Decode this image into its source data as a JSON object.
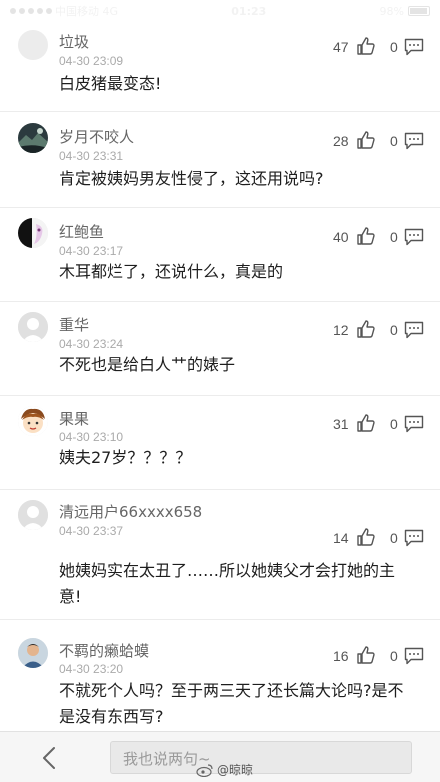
{
  "status_bar": {
    "carrier": "中国移动 4G",
    "time": "01:23",
    "battery": "98%"
  },
  "comments": [
    {
      "username": "垃圾",
      "time": "04-30 23:09",
      "text": "白皮猪最变态!",
      "likes": "47",
      "replies": "0",
      "avatar": "gray-blank-avatar"
    },
    {
      "username": "岁月不咬人",
      "time": "04-30 23:31",
      "text": "肯定被姨妈男友性侵了，这还用说吗?",
      "likes": "28",
      "replies": "0",
      "avatar": "dark-landscape-avatar"
    },
    {
      "username": "红鲍鱼",
      "time": "04-30 23:17",
      "text": "木耳都烂了，还说什么，真是的",
      "likes": "40",
      "replies": "0",
      "avatar": "black-white-cartoon-avatar"
    },
    {
      "username": "重华",
      "time": "04-30 23:24",
      "text": "不死也是给白人艹的婊子",
      "likes": "12",
      "replies": "0",
      "avatar": "default-person-avatar"
    },
    {
      "username": "果果",
      "time": "04-30 23:10",
      "text": "姨夫27岁？？？？",
      "likes": "31",
      "replies": "0",
      "avatar": "cartoon-face-avatar"
    },
    {
      "username": "清远用户66xxxx658",
      "time": "04-30 23:37",
      "text": "她姨妈实在太丑了……所以她姨父才会打她的主意!",
      "likes": "14",
      "replies": "0",
      "avatar": "default-person-avatar"
    },
    {
      "username": "不羁的癞蛤蟆",
      "time": "04-30 23:20",
      "text": "不就死个人吗？至于两三天了还长篇大论吗?是不是没有东西写?",
      "likes": "16",
      "replies": "0",
      "avatar": "photo-man-avatar"
    }
  ],
  "bottom_bar": {
    "input_placeholder": "我也说两句~"
  },
  "watermark": {
    "text": "@晾晾"
  },
  "colors": {
    "text": "#1e1e1e",
    "muted": "#666666",
    "time": "#aaaaaa",
    "divider": "#ececec"
  }
}
